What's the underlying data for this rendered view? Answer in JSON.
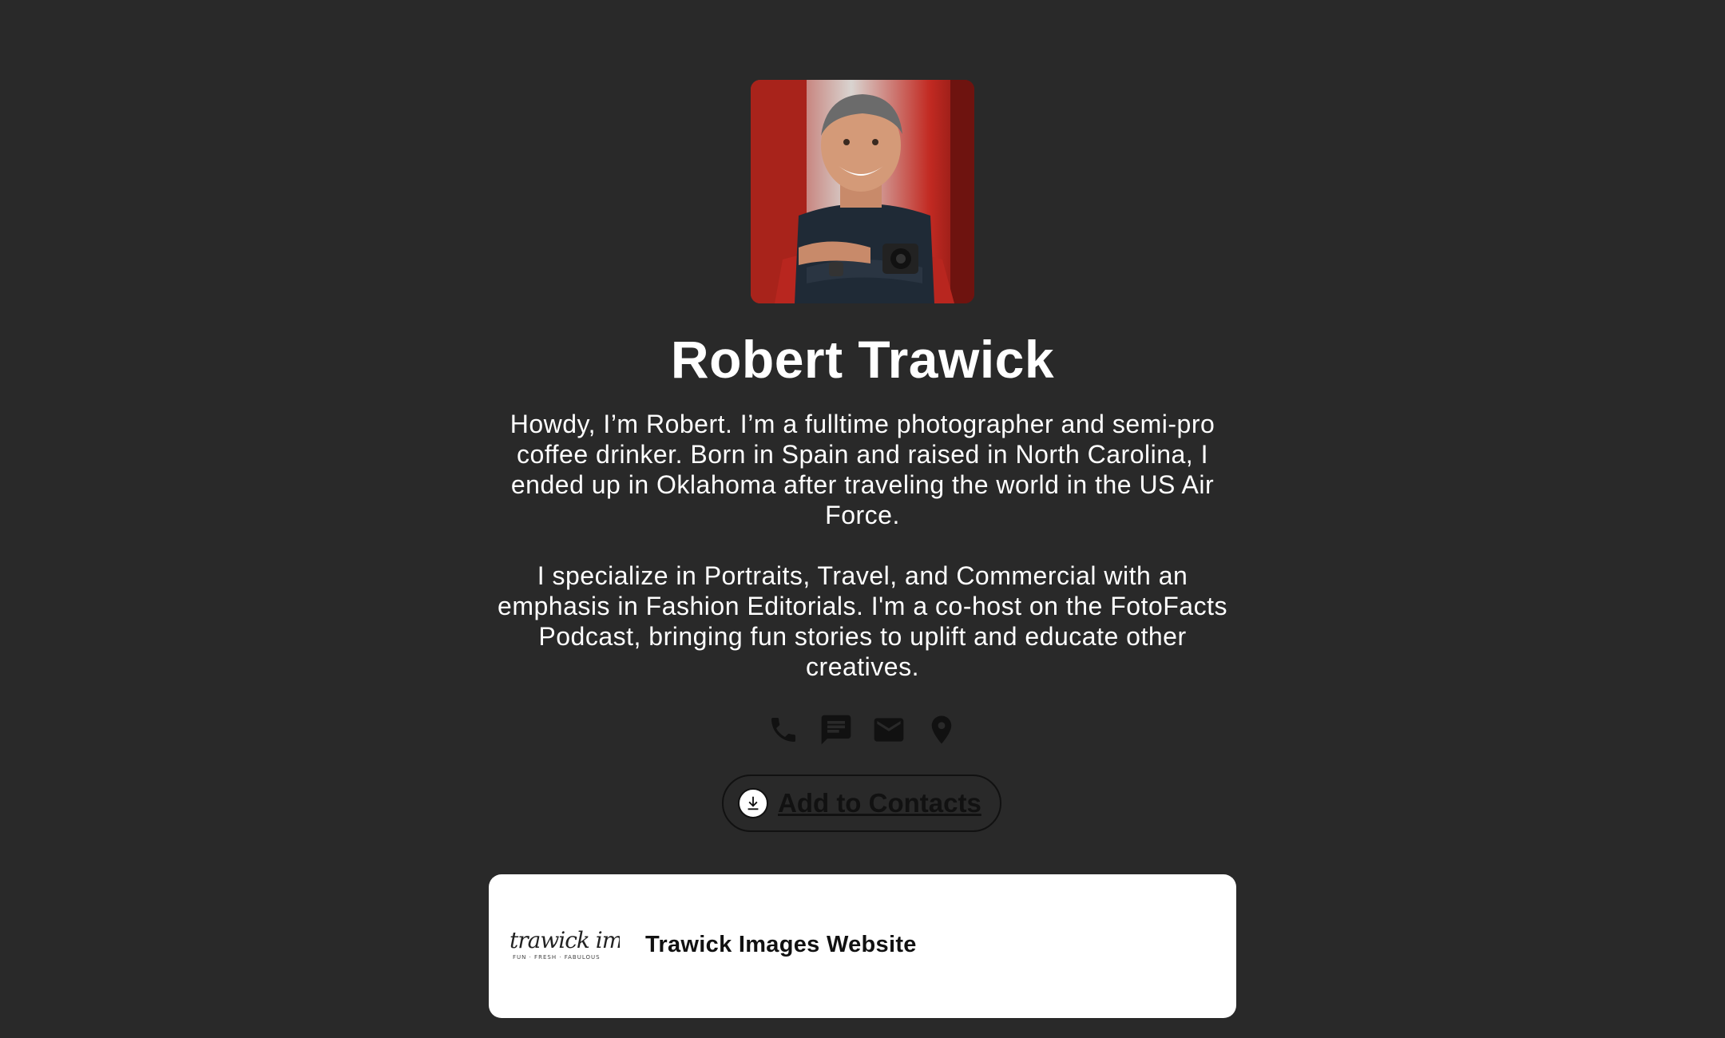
{
  "profile": {
    "name": "Robert Trawick",
    "bio": [
      "Howdy, I’m Robert. I’m a fulltime photographer and semi-pro coffee drinker. Born in Spain and raised in North Carolina, I ended up in Oklahoma after traveling the world in the US Air Force.",
      "I specialize in Portraits, Travel, and Commercial with an emphasis in Fashion Editorials. I'm a co-host on the FotoFacts Podcast, bringing fun stories to uplift and educate other creatives."
    ]
  },
  "contact_icons": [
    "phone-icon",
    "message-icon",
    "email-icon",
    "location-icon"
  ],
  "add_contacts": {
    "label": "Add to Contacts",
    "icon": "download-icon"
  },
  "links": [
    {
      "title": "Trawick Images Website",
      "logo_text": "trawick images",
      "logo_tagline": "FUN · FRESH · FABULOUS"
    }
  ],
  "colors": {
    "background": "#292929",
    "text": "#ffffff",
    "card": "#ffffff",
    "dark": "#111111"
  }
}
